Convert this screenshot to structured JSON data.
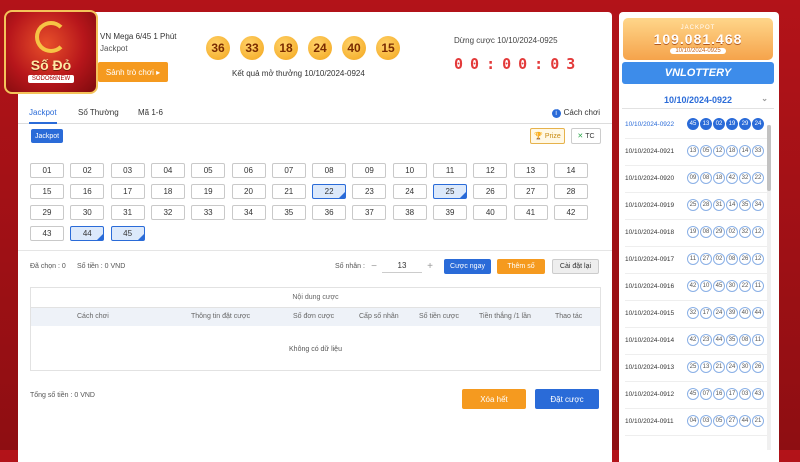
{
  "game": {
    "title": "VN Mega 6/45 1 Phút",
    "mode": "Jackpot",
    "hall_button": "Sảnh trò chơi ▸",
    "logo_brand": "Số Đỏ",
    "logo_sub": "SODO66NEW"
  },
  "last_result": {
    "balls": [
      "36",
      "33",
      "18",
      "24",
      "40",
      "15"
    ],
    "label": "Kết quả mở thưởng 10/10/2024-0924"
  },
  "timer": {
    "stop_label": "Dừng cược 10/10/2024-0925",
    "digits": [
      "0",
      "0",
      ":",
      "0",
      "0",
      ":",
      "0",
      "3"
    ]
  },
  "tabs": [
    "Jackpot",
    "Số Thường",
    "Mã 1-6"
  ],
  "howto_label": "Cách chơi",
  "jackpot_pill": "Jackpot",
  "prize_label": "Prize",
  "tc_label": "TC",
  "numbers": [
    "01",
    "02",
    "03",
    "04",
    "05",
    "06",
    "07",
    "08",
    "09",
    "10",
    "11",
    "12",
    "13",
    "14",
    "15",
    "16",
    "17",
    "18",
    "19",
    "20",
    "21",
    "22",
    "23",
    "24",
    "25",
    "26",
    "27",
    "28",
    "29",
    "30",
    "31",
    "32",
    "33",
    "34",
    "35",
    "36",
    "37",
    "38",
    "39",
    "40",
    "41",
    "42",
    "43",
    "44",
    "45"
  ],
  "selected_numbers": [
    "22",
    "25",
    "44",
    "45"
  ],
  "summary": {
    "chosen": "Đã chọn : 0",
    "amount": "Số tiền : 0 VND",
    "multiplier_label": "Số nhân :",
    "multiplier_value": "13",
    "minus": "−",
    "plus": "+"
  },
  "actions": {
    "bet_now": "Cược ngay",
    "add_number": "Thêm số",
    "reset": "Cài đặt lại",
    "clear_all": "Xóa hết",
    "place_bet": "Đặt cược"
  },
  "bet_table": {
    "caption": "Nội dung cược",
    "columns": [
      "Cách chơi",
      "Thông tin đặt cược",
      "Số đơn cược",
      "Cấp số nhân",
      "Số tiền cược",
      "Tiền thắng /1 lần",
      "Thao tác"
    ],
    "empty": "Không có dữ liệu"
  },
  "total": "Tổng số tiền : 0 VND",
  "jackpot_box": {
    "title": "JACKPOT",
    "amount": "109.081.468",
    "tag": "10/10/2024-0925"
  },
  "vnlottery_label": "VNLOTTERY",
  "history_selected": "10/10/2024-0922",
  "history": [
    {
      "code": "10/10/2024-0922",
      "balls": [
        "45",
        "13",
        "02",
        "19",
        "29",
        "24"
      ],
      "highlight": true
    },
    {
      "code": "10/10/2024-0921",
      "balls": [
        "13",
        "05",
        "12",
        "18",
        "14",
        "33"
      ],
      "highlight": false
    },
    {
      "code": "10/10/2024-0920",
      "balls": [
        "09",
        "08",
        "18",
        "42",
        "32",
        "22"
      ],
      "highlight": false
    },
    {
      "code": "10/10/2024-0919",
      "balls": [
        "25",
        "28",
        "31",
        "14",
        "35",
        "34"
      ],
      "highlight": false
    },
    {
      "code": "10/10/2024-0918",
      "balls": [
        "19",
        "08",
        "29",
        "02",
        "32",
        "12"
      ],
      "highlight": false
    },
    {
      "code": "10/10/2024-0917",
      "balls": [
        "11",
        "27",
        "02",
        "08",
        "26",
        "12"
      ],
      "highlight": false
    },
    {
      "code": "10/10/2024-0916",
      "balls": [
        "42",
        "10",
        "45",
        "30",
        "22",
        "11"
      ],
      "highlight": false
    },
    {
      "code": "10/10/2024-0915",
      "balls": [
        "32",
        "17",
        "24",
        "39",
        "40",
        "44"
      ],
      "highlight": false
    },
    {
      "code": "10/10/2024-0914",
      "balls": [
        "42",
        "23",
        "44",
        "35",
        "08",
        "11"
      ],
      "highlight": false
    },
    {
      "code": "10/10/2024-0913",
      "balls": [
        "25",
        "13",
        "21",
        "24",
        "30",
        "26"
      ],
      "highlight": false
    },
    {
      "code": "10/10/2024-0912",
      "balls": [
        "45",
        "07",
        "16",
        "17",
        "03",
        "43"
      ],
      "highlight": false
    },
    {
      "code": "10/10/2024-0911",
      "balls": [
        "04",
        "03",
        "05",
        "27",
        "44",
        "21"
      ],
      "highlight": false
    }
  ],
  "colors": {
    "accent_blue": "#2a6bd8",
    "orange": "#f59a1f",
    "countdown_red": "#e33a3a",
    "background_red": "#b31319"
  }
}
